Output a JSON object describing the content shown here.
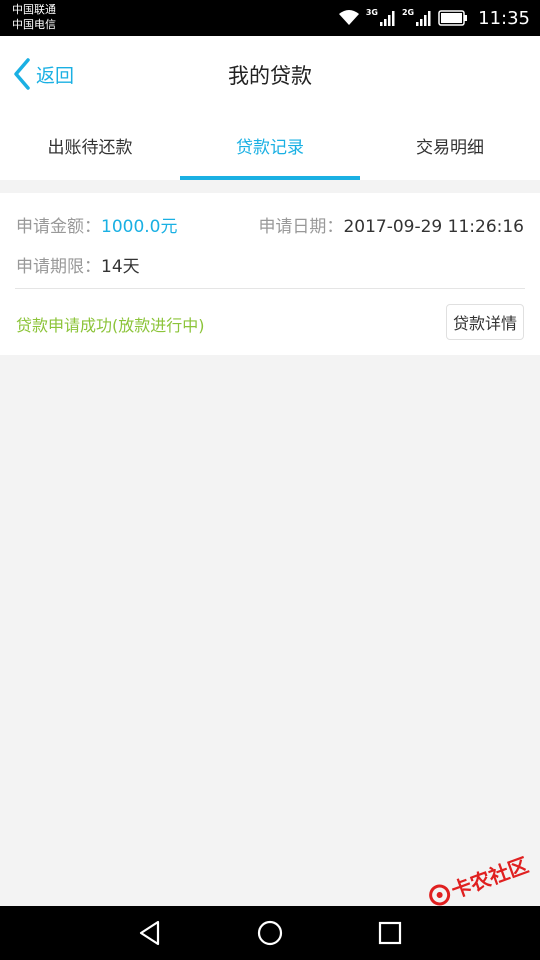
{
  "status_bar": {
    "carrier_1": "中国联通",
    "carrier_2": "中国电信",
    "network_1": "3G",
    "network_2": "2G",
    "time": "11:35",
    "icons": [
      "wifi-icon",
      "signal-icon",
      "signal-icon",
      "battery-icon"
    ]
  },
  "header": {
    "back_label": "返回",
    "title": "我的贷款"
  },
  "tabs": [
    {
      "label": "出账待还款",
      "active": false
    },
    {
      "label": "贷款记录",
      "active": true
    },
    {
      "label": "交易明细",
      "active": false
    }
  ],
  "record": {
    "amount_label": "申请金额：",
    "amount_value": "1000.0元",
    "date_label": "申请日期：",
    "date_value": "2017-09-29 11:26:16",
    "term_label": "申请期限：",
    "term_value": "14天",
    "status": "贷款申请成功(放款进行中)",
    "detail_button": "贷款详情"
  },
  "nav_bar": {
    "icons": [
      "back-triangle-icon",
      "home-circle-icon",
      "recents-square-icon"
    ]
  },
  "watermark": "卡农社区",
  "colors": {
    "accent": "#1ab0e3",
    "success": "#8cc43a",
    "background": "#f3f3f3"
  }
}
